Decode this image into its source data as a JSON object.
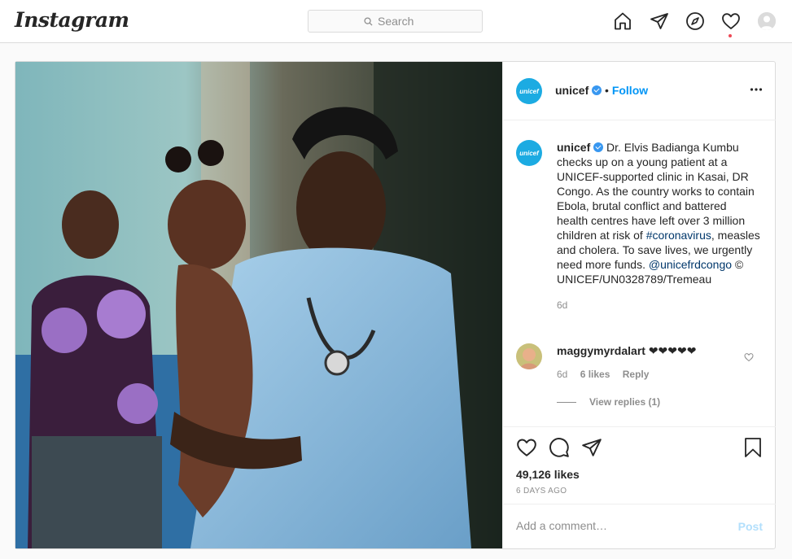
{
  "nav": {
    "logo": "Instagram",
    "search_placeholder": "Search",
    "icons": [
      "home-icon",
      "direct-icon",
      "explore-icon",
      "activity-heart-icon",
      "profile-avatar"
    ]
  },
  "post": {
    "author": "unicef",
    "separator": "•",
    "follow_label": "Follow",
    "caption_user": "unicef",
    "caption_part1": " Dr. Elvis Badianga Kumbu checks up on a young patient at a UNICEF-supported clinic in Kasai, DR Congo. As the country works to contain Ebola, brutal conflict and battered health centres have left over 3 million children at risk of ",
    "hashtag": "#coronavirus",
    "caption_part2": ", measles and cholera. To save lives, we urgently need more funds. ",
    "mention": "@unicefrdcongo",
    "caption_part3": " © UNICEF/UN0328789/Tremeau",
    "caption_time": "6d",
    "comment": {
      "user": "maggymyrdalart",
      "text": " ❤❤❤❤❤",
      "time": "6d",
      "likes": "6 likes",
      "reply_label": "Reply",
      "view_replies": "View replies (1)"
    },
    "likes": "49,126 likes",
    "date": "6 DAYS AGO",
    "add_comment_placeholder": "Add a comment…",
    "post_button": "Post",
    "avatar_text": "unicef"
  },
  "colors": {
    "accent": "#0095f6",
    "unicef_blue": "#1cabe2",
    "notification_dot": "#ed4956"
  }
}
